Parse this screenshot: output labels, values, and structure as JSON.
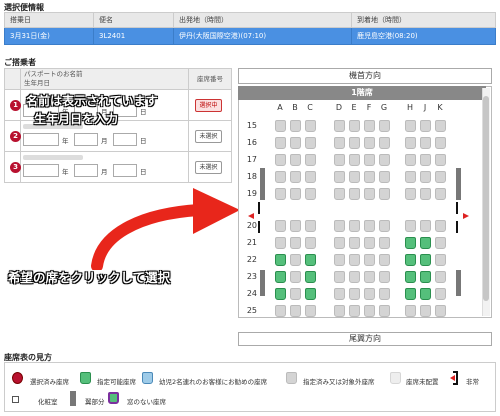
{
  "flight_section": {
    "title": "選択便情報",
    "headers": [
      "搭乗日",
      "便名",
      "出発地（時間）",
      "到着地（時間）"
    ],
    "row": [
      "3月31日(金)",
      "3L2401",
      "伊丹(大阪国際空港)(07:10)",
      "鹿児島空港(08:20)"
    ]
  },
  "passenger_section": {
    "title": "ご搭乗者",
    "header_name_1": "パスポートのお名前",
    "header_name_2": "生年月日",
    "header_seat": "座席番号",
    "year_label": "年",
    "month_label": "月",
    "day_label": "日",
    "rows": [
      {
        "num": "1",
        "seat_status": "選択中"
      },
      {
        "num": "2",
        "seat_status": "未選択"
      },
      {
        "num": "3",
        "seat_status": "未選択"
      }
    ]
  },
  "annotations": {
    "name_note": "名前は表示されています",
    "birth_note": "生年月日を入力",
    "click_note": "希望の席をクリックして選択"
  },
  "seatmap": {
    "front_label": "機首方向",
    "deck_label": "1階席",
    "rear_label": "尾翼方向",
    "columns_left": [
      "A",
      "B",
      "C"
    ],
    "columns_mid": [
      "D",
      "E",
      "F",
      "G"
    ],
    "columns_right": [
      "H",
      "J",
      "K"
    ],
    "rows": [
      "15",
      "16",
      "17",
      "18",
      "19",
      "20",
      "21",
      "22",
      "23",
      "24",
      "25"
    ],
    "seats": {
      "15": {
        "A": "u",
        "B": "u",
        "C": "u",
        "D": "u",
        "E": "u",
        "F": "u",
        "G": "u",
        "H": "u",
        "J": "u",
        "K": "u"
      },
      "16": {
        "A": "u",
        "B": "u",
        "C": "u",
        "D": "u",
        "E": "u",
        "F": "u",
        "G": "u",
        "H": "u",
        "J": "u",
        "K": "u"
      },
      "17": {
        "A": "u",
        "B": "u",
        "C": "u",
        "D": "u",
        "E": "u",
        "F": "u",
        "G": "u",
        "H": "u",
        "J": "u",
        "K": "u"
      },
      "18": {
        "A": "u",
        "B": "u",
        "C": "u",
        "D": "u",
        "E": "u",
        "F": "u",
        "G": "u",
        "H": "u",
        "J": "u",
        "K": "u"
      },
      "19": {
        "A": "u",
        "B": "u",
        "C": "u",
        "D": "u",
        "E": "u",
        "F": "u",
        "G": "u",
        "H": "u",
        "J": "u",
        "K": "u"
      },
      "20": {
        "A": "u",
        "B": "u",
        "C": "u",
        "D": "u",
        "E": "u",
        "F": "u",
        "G": "u",
        "H": "u",
        "J": "u",
        "K": "u"
      },
      "21": {
        "A": "u",
        "B": "u",
        "C": "u",
        "D": "u",
        "E": "u",
        "F": "u",
        "G": "u",
        "H": "a",
        "J": "a",
        "K": "u"
      },
      "22": {
        "A": "a",
        "B": "u",
        "C": "a",
        "D": "u",
        "E": "u",
        "F": "u",
        "G": "u",
        "H": "a",
        "J": "a",
        "K": "u"
      },
      "23": {
        "A": "a",
        "B": "u",
        "C": "a",
        "D": "u",
        "E": "u",
        "F": "u",
        "G": "u",
        "H": "a",
        "J": "a",
        "K": "u"
      },
      "24": {
        "A": "a",
        "B": "u",
        "C": "a",
        "D": "u",
        "E": "u",
        "F": "u",
        "G": "u",
        "H": "a",
        "J": "a",
        "K": "u"
      },
      "25": {
        "A": "u",
        "B": "u",
        "C": "u",
        "D": "u",
        "E": "u",
        "F": "u",
        "G": "u",
        "H": "u",
        "J": "u",
        "K": "u"
      }
    }
  },
  "legend": {
    "title": "座席表の見方",
    "selected": "選択済み座席",
    "available": "指定可能座席",
    "infant": "幼児2名連れのお客様にお勧めの座席",
    "unavailable": "指定済み又は対象外座席",
    "not_placed": "座席未配置",
    "exit": "非常",
    "lavatory": "化粧室",
    "wing": "翼部分",
    "no_window": "窓のない座席"
  },
  "colors": {
    "header_blue": "#4a90e2",
    "badge_red": "#b8112f",
    "seat_available": "#55bf7b",
    "seat_unavailable": "#d4d4d4",
    "arrow_red": "#e8261b"
  }
}
